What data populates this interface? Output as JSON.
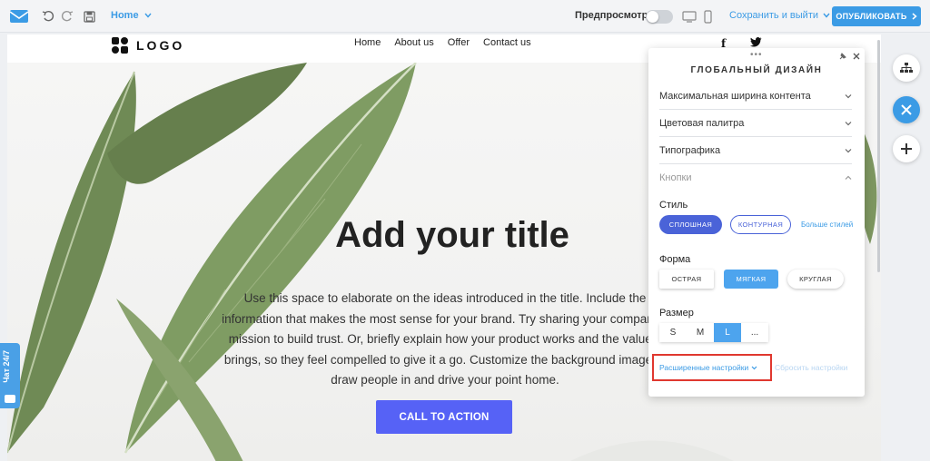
{
  "toolbar": {
    "page_select": "Home",
    "preview_label": "Предпросмотр",
    "save_exit_label": "Сохранить и выйти",
    "publish_label": "ОПУБЛИКОВАТЬ",
    "icons": [
      "mail-icon",
      "undo-icon",
      "redo-icon",
      "save-icon",
      "desktop-icon",
      "mobile-icon"
    ]
  },
  "site": {
    "logo_text": "LOGO",
    "nav": [
      "Home",
      "About us",
      "Offer",
      "Contact us"
    ],
    "social": {
      "facebook": "f",
      "twitter": "twitter-icon"
    },
    "hero_title": "Add your title",
    "hero_body": "Use this space to elaborate on the ideas introduced in the title. Include the information that makes the most sense for your brand. Try sharing your company's mission to build trust. Or, briefly explain how your product works and the value it brings, so they feel compelled to give it a go. Customize the background image to draw people in and drive your point home.",
    "cta_label": "CALL TO ACTION"
  },
  "chat": {
    "label": "Чат 24/7"
  },
  "panel": {
    "title": "ГЛОБАЛЬНЫЙ ДИЗАЙН",
    "accordion": [
      "Максимальная ширина контента",
      "Цветовая палитра",
      "Типографика",
      "Кнопки"
    ],
    "style": {
      "label": "Стиль",
      "solid": "СПЛОШНАЯ",
      "outline": "КОНТУРНАЯ",
      "more": "Больше стилей"
    },
    "form": {
      "label": "Форма",
      "options": [
        "ОСТРАЯ",
        "МЯГКАЯ",
        "КРУГЛАЯ"
      ],
      "selected": "МЯГКАЯ"
    },
    "size": {
      "label": "Размер",
      "options": [
        "S",
        "M",
        "L",
        "..."
      ],
      "selected": "L"
    },
    "advanced_label": "Расширенные настройки",
    "reset_label": "Сбросить настройки"
  },
  "colors": {
    "accent": "#3b9be5",
    "cta": "#5662f6",
    "button_style": "#4a63d8",
    "highlight": "#e0382f"
  }
}
